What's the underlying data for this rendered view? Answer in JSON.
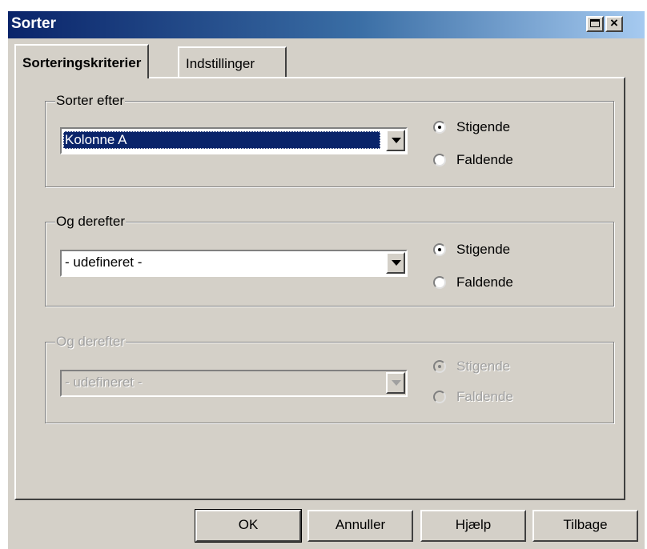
{
  "window": {
    "title": "Sorter"
  },
  "titlebar": {
    "close_label": "×"
  },
  "tabs": [
    {
      "label": "Sorteringskriterier",
      "active": true
    },
    {
      "label": "Indstillinger",
      "active": false
    }
  ],
  "groups": [
    {
      "legend": "Sorter efter",
      "enabled": true,
      "combo_value": "Kolonne A",
      "radios": [
        {
          "label": "Stigende",
          "checked": true
        },
        {
          "label": "Faldende",
          "checked": false
        }
      ]
    },
    {
      "legend": "Og derefter",
      "enabled": true,
      "combo_value": "- udefineret -",
      "radios": [
        {
          "label": "Stigende",
          "checked": true
        },
        {
          "label": "Faldende",
          "checked": false
        }
      ]
    },
    {
      "legend": "Og derefter",
      "enabled": false,
      "combo_value": "- udefineret -",
      "radios": [
        {
          "label": "Stigende",
          "checked": true
        },
        {
          "label": "Faldende",
          "checked": false
        }
      ]
    }
  ],
  "buttons": {
    "ok": "OK",
    "cancel": "Annuller",
    "help": "Hjælp",
    "back": "Tilbage"
  },
  "colors": {
    "face": "#d4d0c8",
    "title_start": "#0a246a",
    "title_end": "#a6caf0",
    "selection": "#0a246a"
  }
}
